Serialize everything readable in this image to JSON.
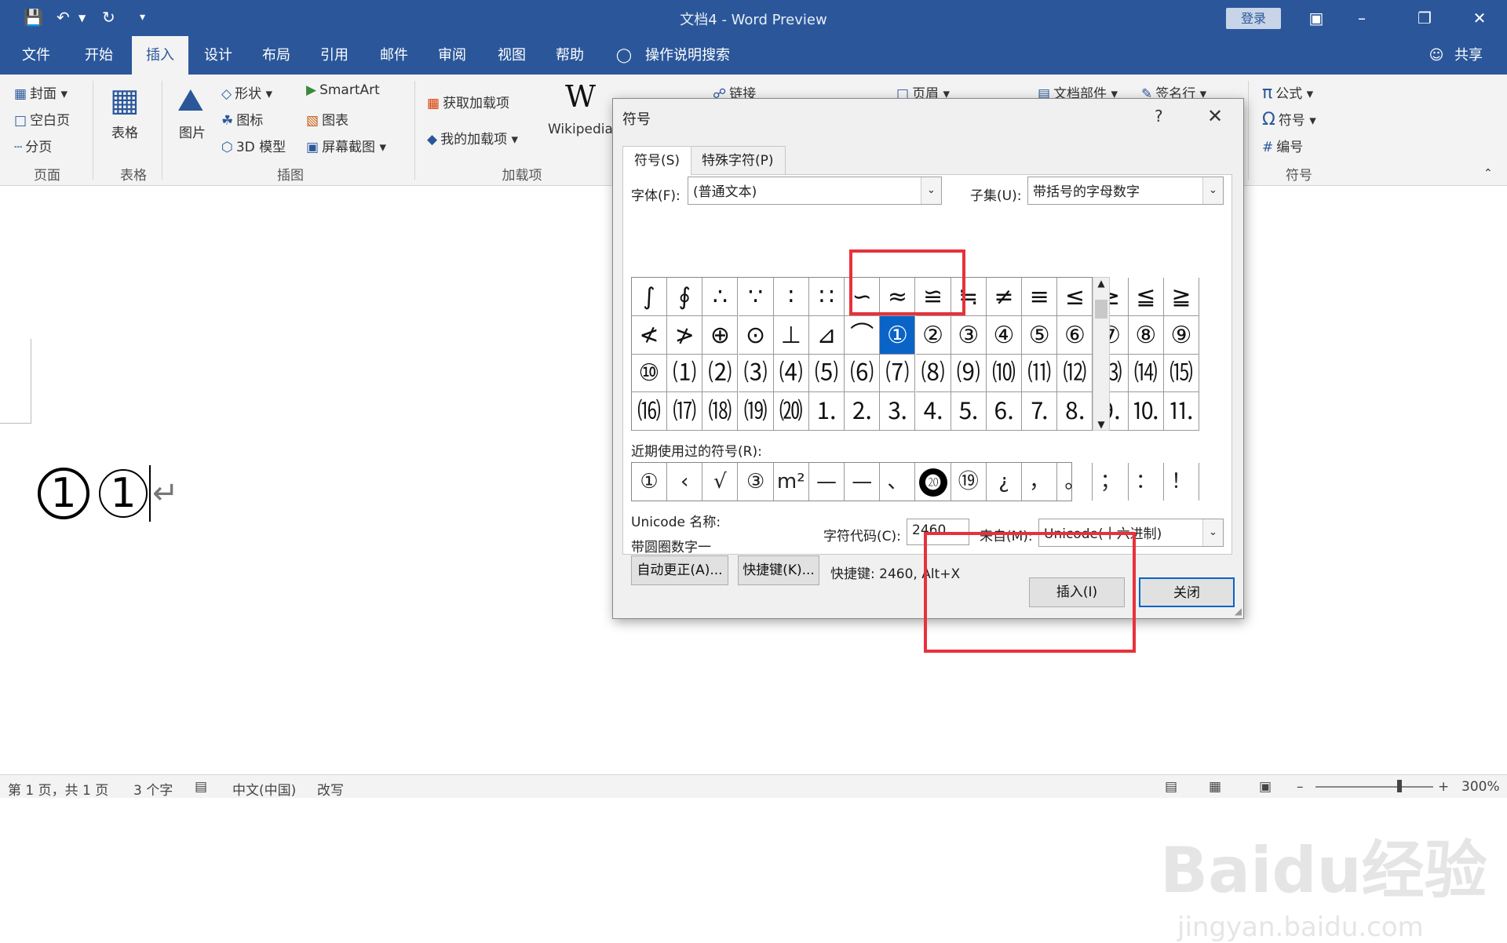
{
  "app": {
    "title": "文档4  -  Word Preview",
    "login": "登录",
    "share": "共享",
    "tabs": [
      "文件",
      "开始",
      "插入",
      "设计",
      "布局",
      "引用",
      "邮件",
      "审阅",
      "视图",
      "帮助"
    ],
    "search_hint": "操作说明搜索",
    "active_tab": "插入"
  },
  "ribbon": {
    "pages": {
      "cover": "封面",
      "blank": "空白页",
      "break": "分页",
      "label": "页面"
    },
    "table": {
      "btn": "表格",
      "label": "表格"
    },
    "illus": {
      "picture": "图片",
      "shapes": "形状",
      "icons": "图标",
      "model3d": "3D 模型",
      "smartart": "SmartArt",
      "chart": "图表",
      "screenshot": "屏幕截图",
      "label": "插图"
    },
    "addins": {
      "get": "获取加载项",
      "mine": "我的加载项",
      "wiki": "Wikipedia",
      "label": "加载项"
    },
    "links": {
      "link": "链接"
    },
    "header": {
      "header": "页眉"
    },
    "text": {
      "parts": "文档部件",
      "sig": "签名行"
    },
    "symbols": {
      "equation": "公式",
      "symbol": "符号",
      "number": "编号",
      "label": "符号"
    }
  },
  "document": {
    "char1": "1",
    "char2": "1",
    "para_mark": "↵"
  },
  "dialog": {
    "title": "符号",
    "help": "?",
    "tab_symbols": "符号(S)",
    "tab_special": "特殊字符(P)",
    "font_label": "字体(F):",
    "font_value": "(普通文本)",
    "subset_label": "子集(U):",
    "subset_value": "带括号的字母数字",
    "grid_rows": [
      [
        "∫",
        "∮",
        "∴",
        "∵",
        "∶",
        "∷",
        "∽",
        "≈",
        "≌",
        "≒",
        "≠",
        "≡",
        "≤",
        "≥",
        "≦",
        "≧"
      ],
      [
        "≮",
        "≯",
        "⊕",
        "⊙",
        "⊥",
        "⊿",
        "⌒",
        "①",
        "②",
        "③",
        "④",
        "⑤",
        "⑥",
        "⑦",
        "⑧",
        "⑨"
      ],
      [
        "⑩",
        "⑴",
        "⑵",
        "⑶",
        "⑷",
        "⑸",
        "⑹",
        "⑺",
        "⑻",
        "⑼",
        "⑽",
        "⑾",
        "⑿",
        "⒀",
        "⒁",
        "⒂"
      ],
      [
        "⒃",
        "⒄",
        "⒅",
        "⒆",
        "⒇",
        "⒈",
        "⒉",
        "⒊",
        "⒋",
        "⒌",
        "⒍",
        "⒎",
        "⒏",
        "⒐",
        "⒑",
        "⒒"
      ]
    ],
    "selected": {
      "row": 1,
      "col": 7
    },
    "recent_label": "近期使用过的符号(R):",
    "recent": [
      "①",
      "‹",
      "√",
      "③",
      "m²",
      "—",
      "—",
      "、",
      "⓴",
      "⑲",
      "¿",
      "，",
      "。",
      "；",
      "：",
      "！"
    ],
    "recent_inverse_index": 8,
    "unicode_name_label": "Unicode 名称:",
    "unicode_name": "带圆圈数字一",
    "code_label": "字符代码(C):",
    "code_value": "2460",
    "from_label": "来自(M):",
    "from_value": "Unicode(十六进制)",
    "autocorrect": "自动更正(A)...",
    "shortcut_btn": "快捷键(K)...",
    "shortcut_text": "快捷键: 2460, Alt+X",
    "insert": "插入(I)",
    "close": "关闭"
  },
  "status": {
    "page": "第 1 页，共 1 页",
    "words": "3 个字",
    "lang": "中文(中国)",
    "mode": "改写",
    "zoom": "300%"
  },
  "watermark": {
    "logo": "Baidu经验",
    "url": "jingyan.baidu.com"
  },
  "colors": {
    "accent": "#2b579a",
    "highlight": "#0a64c8",
    "annotation": "#e8313a"
  }
}
